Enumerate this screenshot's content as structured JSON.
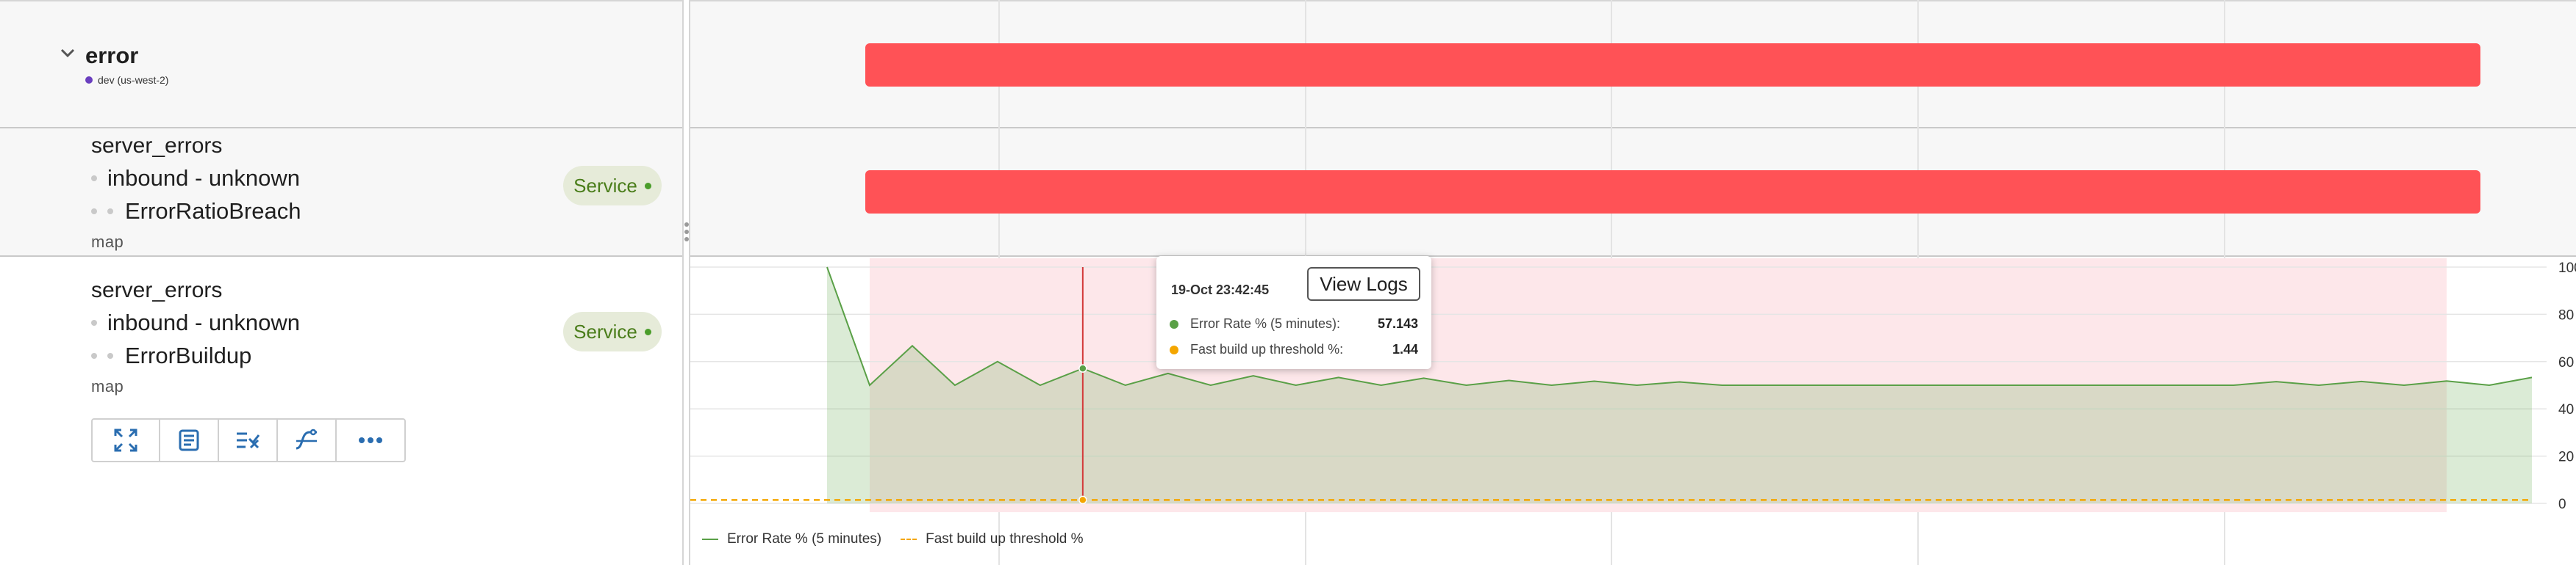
{
  "group": {
    "title": "error",
    "environment": "dev (us-west-2)",
    "env_color": "#6a3fbf"
  },
  "rows": [
    {
      "name": "server_errors",
      "sub1": "inbound - unknown",
      "sub2": "ErrorRatioBreach",
      "kind": "map",
      "badge": "Service"
    },
    {
      "name": "server_errors",
      "sub1": "inbound - unknown",
      "sub2": "ErrorBuildup",
      "kind": "map",
      "badge": "Service"
    }
  ],
  "toolbar": {
    "icons": [
      "expand-icon",
      "logs-icon",
      "alert-rules-icon",
      "trace-icon",
      "more-icon"
    ]
  },
  "tooltip": {
    "time": "19-Oct 23:42:45",
    "button": "View Logs",
    "series": [
      {
        "label": "Error Rate % (5 minutes):",
        "value": "57.143",
        "color": "#5aa047"
      },
      {
        "label": "Fast build up threshold %:",
        "value": "1.44",
        "color": "#f4a600"
      }
    ]
  },
  "colors": {
    "incident_bar": "#ff5256",
    "incident_shade": "#fde7ea",
    "error_series": "#5aa047",
    "threshold": "#f4a600",
    "badge_text": "#4a7d1a",
    "badge_bg": "#e6ebd9"
  },
  "chart_data": {
    "type": "area",
    "x": [
      0,
      1,
      2,
      3,
      4,
      5,
      6,
      7,
      8,
      9,
      10,
      11,
      12,
      13,
      14,
      15,
      16,
      17,
      18,
      19,
      20,
      21,
      22,
      23,
      24,
      25,
      26,
      27,
      28,
      29,
      30,
      31,
      32,
      33,
      34,
      35,
      36,
      37,
      38,
      39,
      40
    ],
    "series": [
      {
        "name": "Error Rate % (5 minutes)",
        "values": [
          100,
          50,
          66.7,
          50,
          60,
          50,
          57.1,
          50,
          55,
          50,
          54,
          50,
          53.3,
          50,
          53,
          50,
          52,
          50,
          51.7,
          50,
          51.4,
          50,
          50,
          50,
          50,
          50,
          50,
          50,
          50,
          50,
          50,
          50,
          50,
          50,
          51.5,
          50,
          51.6,
          50,
          51.8,
          50,
          53.3
        ]
      },
      {
        "name": "Fast build up threshold %",
        "values": [
          1.44,
          1.44,
          1.44,
          1.44,
          1.44,
          1.44,
          1.44,
          1.44,
          1.44,
          1.44,
          1.44,
          1.44,
          1.44,
          1.44,
          1.44,
          1.44,
          1.44,
          1.44,
          1.44,
          1.44,
          1.44,
          1.44,
          1.44,
          1.44,
          1.44,
          1.44,
          1.44,
          1.44,
          1.44,
          1.44,
          1.44,
          1.44,
          1.44,
          1.44,
          1.44,
          1.44,
          1.44,
          1.44,
          1.44,
          1.44,
          1.44
        ]
      }
    ],
    "y_ticks": [
      "100",
      "80",
      "60",
      "40",
      "20",
      "0"
    ],
    "ylim": [
      0,
      100
    ],
    "grid": true,
    "legend": "bottom-left",
    "incident_window": [
      1,
      38
    ],
    "cursor_index": 6
  }
}
